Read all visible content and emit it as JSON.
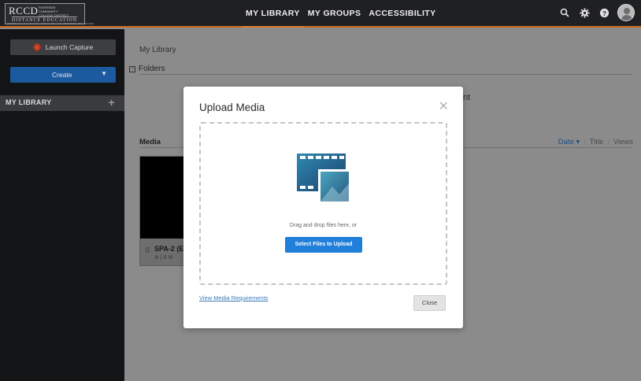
{
  "header": {
    "logo": {
      "acronym": "RCCD",
      "subtitle": "RIVERSIDE COMMUNITY COLLEGE DISTRICT",
      "department": "DISTANCE EDUCATION",
      "colleges": "MORENO VALLEY COLLEGE | NORCO COLLEGE | RIVERSIDE CITY COLLEGE"
    },
    "tabs": [
      {
        "label": "MY LIBRARY",
        "active": true
      },
      {
        "label": "MY GROUPS",
        "active": false
      },
      {
        "label": "ACCESSIBILITY",
        "active": false
      }
    ],
    "icons": [
      "search-icon",
      "gear-icon",
      "help-icon",
      "avatar"
    ],
    "accent_color": "#d67a2a"
  },
  "sidebar": {
    "launch_label": "Launch Capture",
    "create_label": "Create",
    "create_arrow": "▼",
    "library_label": "MY LIBRARY",
    "library_plus": "+"
  },
  "main": {
    "breadcrumb": "My Library",
    "folders_toggle": "−",
    "folders_label": "Folders",
    "partial_text": "nt",
    "media_label": "Media",
    "sort": {
      "date": "Date",
      "title": "Title",
      "views": "Views",
      "separator": "|"
    },
    "card": {
      "title": "SPA-2 (E",
      "meta": "⊘ | 0 Vi",
      "grip": "⠿"
    }
  },
  "modal": {
    "title": "Upload Media",
    "close_symbol": "✕",
    "drag_text": "Drag and drop files here, or",
    "select_button": "Select Files to Upload",
    "requirements_link": "View Media Requirements",
    "close_button": "Close",
    "primary_color": "#1f7fd9"
  }
}
